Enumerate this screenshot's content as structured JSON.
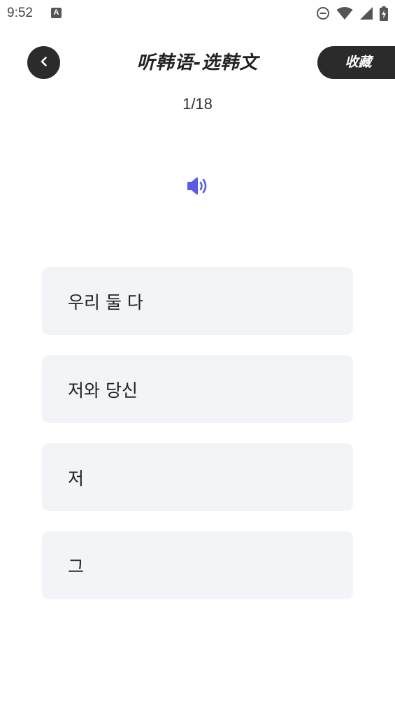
{
  "status_bar": {
    "time": "9:52",
    "notification_icon": "A",
    "icons": [
      "do-not-disturb-icon",
      "wifi-icon",
      "cellular-signal-icon",
      "battery-charging-icon"
    ]
  },
  "header": {
    "back_icon": "chevron-left-icon",
    "title": "听韩语-选韩文",
    "favorite_label": "收藏"
  },
  "progress": {
    "label": "1/18",
    "current": 1,
    "total": 18
  },
  "audio": {
    "icon": "speaker-icon"
  },
  "options": [
    {
      "label": "우리 둘 다"
    },
    {
      "label": "저와 당신"
    },
    {
      "label": "저"
    },
    {
      "label": "그"
    }
  ],
  "colors": {
    "dark": "#2b2b2b",
    "accent": "#5b5be6",
    "option_bg": "#f3f4f8"
  }
}
